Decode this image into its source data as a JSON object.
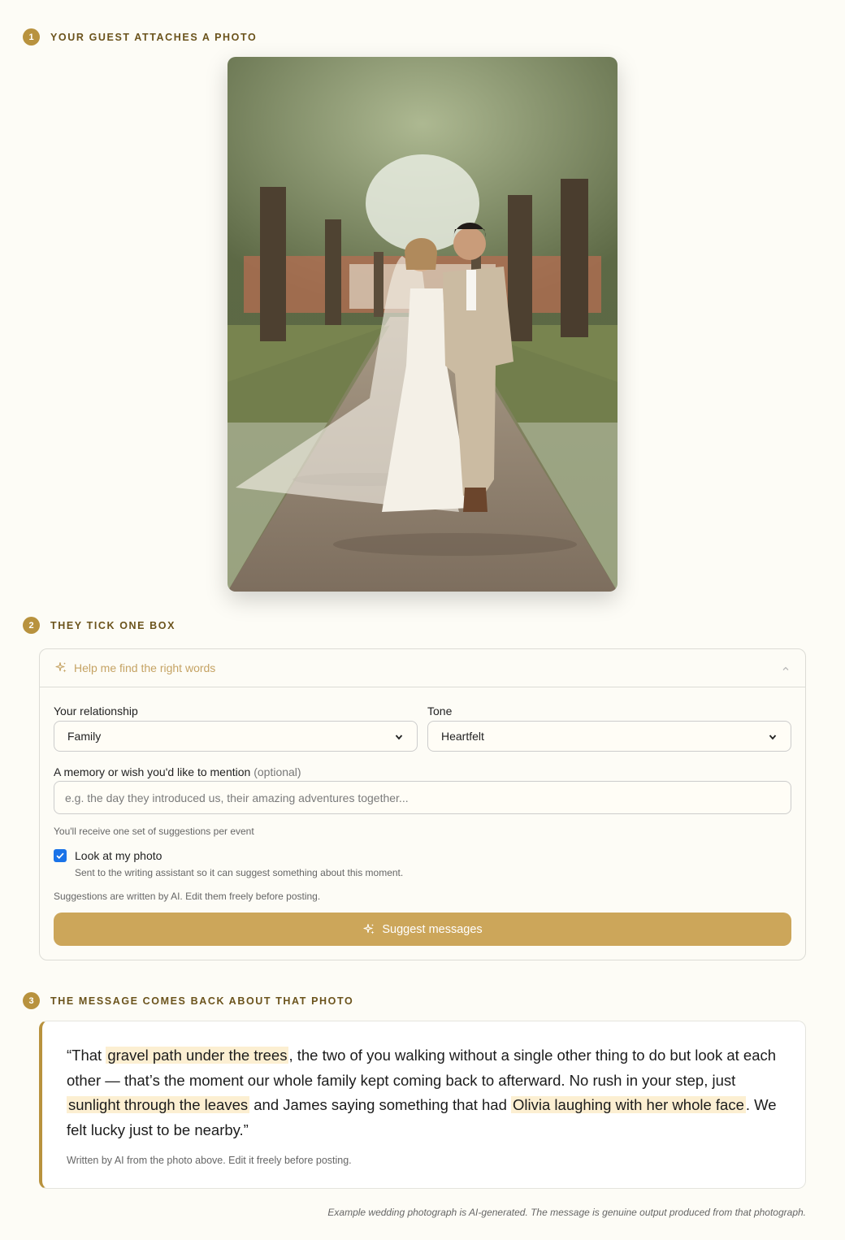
{
  "steps": [
    {
      "num": "1",
      "label": "Your guest attaches a photo"
    },
    {
      "num": "2",
      "label": "They tick one box"
    },
    {
      "num": "3",
      "label": "The message comes back about that photo"
    }
  ],
  "form": {
    "header": "Help me find the right words",
    "relationship_label": "Your relationship",
    "relationship_value": "Family",
    "tone_label": "Tone",
    "tone_value": "Heartfelt",
    "memory_label": "A memory or wish you'd like to mention",
    "memory_optional": "(optional)",
    "memory_placeholder": "e.g. the day they introduced us, their amazing adventures together...",
    "quota_note": "You'll receive one set of suggestions per event",
    "photo_checkbox_label": "Look at my photo",
    "photo_checkbox_checked": true,
    "photo_checkbox_desc": "Sent to the writing assistant so it can suggest something about this moment.",
    "ai_note": "Suggestions are written by AI. Edit them freely before posting.",
    "suggest_button": "Suggest messages"
  },
  "message": {
    "parts": [
      {
        "text": "“That ",
        "hl": false
      },
      {
        "text": "gravel path under the trees",
        "hl": true
      },
      {
        "text": ", the two of you walking without a single other thing to do but look at each other — that’s the moment our whole family kept coming back to afterward. No rush in your step, just ",
        "hl": false
      },
      {
        "text": "sunlight through the leaves",
        "hl": true
      },
      {
        "text": " and James saying something that had ",
        "hl": false
      },
      {
        "text": "Olivia laughing with her whole face",
        "hl": true
      },
      {
        "text": ". We felt lucky just to be nearby.”",
        "hl": false
      }
    ],
    "note": "Written by AI from the photo above. Edit it freely before posting."
  },
  "disclaimer": "Example wedding photograph is AI-generated. The message is genuine output produced from that photograph.",
  "colors": {
    "accent": "#b8923e",
    "button": "#cca65a",
    "highlight": "#fcefd2",
    "background": "#fdfcf6"
  },
  "icons": {
    "sparkle": "sparkle-icon",
    "chevron_up": "chevron-up-icon",
    "caret_down": "chevron-down-icon",
    "check": "check-icon"
  }
}
